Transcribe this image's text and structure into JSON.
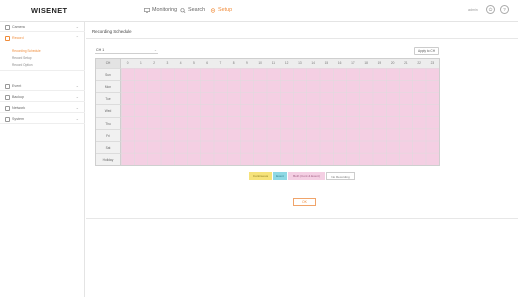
{
  "header": {
    "logo": "WISENET",
    "nav": [
      {
        "label": "Monitoring",
        "icon": "monitor-icon"
      },
      {
        "label": "Search",
        "icon": "search-icon"
      },
      {
        "label": "Setup",
        "icon": "gear-icon",
        "active": true
      }
    ],
    "user": "admin",
    "icons": [
      "logout-icon",
      "help-icon"
    ]
  },
  "sidebar": {
    "items": [
      {
        "label": "Camera",
        "icon": "camera-icon"
      },
      {
        "label": "Record",
        "icon": "record-icon",
        "active": true,
        "sub": [
          {
            "label": "Recording Schedule",
            "active": true
          },
          {
            "label": "Record Setup"
          },
          {
            "label": "Record Option"
          }
        ]
      },
      {
        "label": "Event",
        "icon": "event-icon"
      },
      {
        "label": "Backup",
        "icon": "backup-icon"
      },
      {
        "label": "Network",
        "icon": "network-icon"
      },
      {
        "label": "System",
        "icon": "system-icon"
      }
    ]
  },
  "main": {
    "title": "Recording Schedule",
    "channel_select": "CH 1",
    "apply_button": "Apply to CH",
    "grid": {
      "corner": "CH",
      "hours": [
        "0",
        "1",
        "2",
        "3",
        "4",
        "5",
        "6",
        "7",
        "8",
        "9",
        "10",
        "11",
        "12",
        "13",
        "14",
        "15",
        "16",
        "17",
        "18",
        "19",
        "20",
        "21",
        "22",
        "23"
      ],
      "days": [
        "Sun",
        "Mon",
        "Tue",
        "Wed",
        "Thu",
        "Fri",
        "Sat",
        "Holiday"
      ],
      "cell_color": "#f4cfe3"
    },
    "legend": [
      {
        "label": "Continuous",
        "color": "#f6e27a"
      },
      {
        "label": "Event",
        "color": "#8fd8e4"
      },
      {
        "label": "Both (Cont & Event)",
        "color": "#f4cfe3"
      },
      {
        "label": "No Recording",
        "color": "#ffffff"
      }
    ],
    "ok_button": "OK"
  },
  "accent_color": "#f08c3a"
}
